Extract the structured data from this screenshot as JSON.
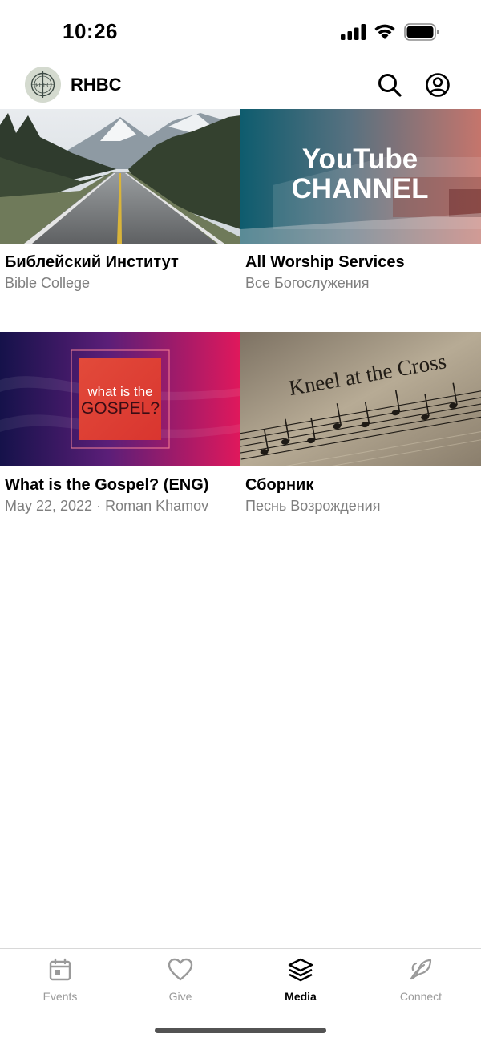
{
  "status_bar": {
    "time": "10:26",
    "icons": [
      "signal-icon",
      "wifi-icon",
      "battery-icon"
    ]
  },
  "header": {
    "logo_text": "RHBC",
    "title": "RHBC",
    "icons": [
      "search-icon",
      "account-icon"
    ]
  },
  "media": {
    "items": [
      {
        "title": "Библейский Институт",
        "subtitle": "Bible College",
        "thumbnail": "mountain-road-photo"
      },
      {
        "title": "All Worship Services",
        "subtitle": "Все Богослужения",
        "thumbnail": "youtube-channel-banner",
        "thumb_text_1": "YouTube",
        "thumb_text_2": "CHANNEL"
      },
      {
        "title": "What is the Gospel? (ENG)",
        "subtitle": "May 22, 2022 · Roman Khamov",
        "thumbnail": "gospel-graphic",
        "thumb_text_1": "what is the",
        "thumb_text_2": "GOSPEL?"
      },
      {
        "title": "Сборник",
        "subtitle": "Песнь Возрождения",
        "thumbnail": "hymn-sheet-photo",
        "thumb_text_1": "Kneel at the Cross"
      }
    ]
  },
  "tab_bar": {
    "tabs": [
      {
        "label": "Events",
        "icon": "calendar-icon",
        "active": false
      },
      {
        "label": "Give",
        "icon": "heart-icon",
        "active": false
      },
      {
        "label": "Media",
        "icon": "layers-icon",
        "active": true
      },
      {
        "label": "Connect",
        "icon": "leaf-icon",
        "active": false
      }
    ]
  },
  "colors": {
    "active_tab": "#000000",
    "inactive_tab": "#9a9a9a",
    "subtitle": "#7f7f7f"
  }
}
